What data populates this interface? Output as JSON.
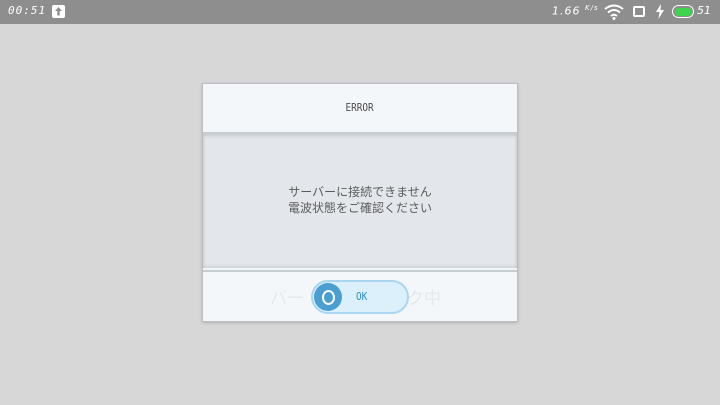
{
  "status_bar": {
    "time": "00:51",
    "upload_icon": "upload-arrow-icon",
    "net_speed": "1.66",
    "net_speed_unit": "K/s",
    "wifi_icon": "wifi-icon",
    "screen_icon": "screen-icon",
    "charging_icon": "charging-bolt-icon",
    "battery_icon": "battery-icon",
    "battery_level": "51",
    "battery_color": "#3fd44e"
  },
  "dialog": {
    "title": "ERROR",
    "message_line1": "サーバーに接続できません",
    "message_line2": "電波状態をご確認ください",
    "ok_label": "OK",
    "ok_icon": "ring-icon",
    "background_text_left": "バー",
    "background_text_right": "ク中",
    "accent_color": "#4b9fd0"
  }
}
